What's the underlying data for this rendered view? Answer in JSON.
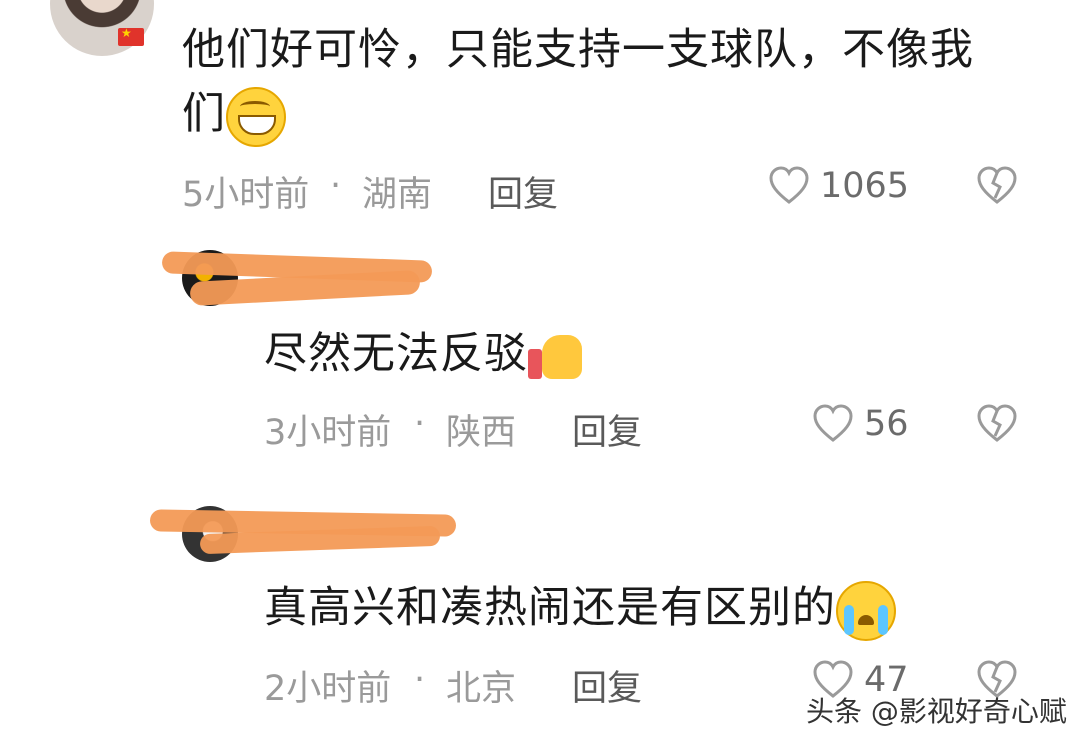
{
  "comments": [
    {
      "text": "他们好可怜，只能支持一支球队，不像我们",
      "emoji": "grinning-face-emoji",
      "time": "5小时前",
      "location": "湖南",
      "separator": "·",
      "reply_label": "回复",
      "likes": "1065"
    },
    {
      "text": "尽然无法反驳",
      "emoji": "thumbs-up-emoji",
      "time": "3小时前",
      "location": "陕西",
      "separator": "·",
      "reply_label": "回复",
      "likes": "56"
    },
    {
      "text": "真高兴和凑热闹还是有区别的",
      "emoji": "crying-face-emoji",
      "time": "2小时前",
      "location": "北京",
      "separator": "·",
      "reply_label": "回复",
      "likes": "47"
    }
  ],
  "watermark": "头条 @影视好奇心赋",
  "colors": {
    "redaction": "#f39a56",
    "meta_text": "#9a9a9a",
    "icon": "#9a9a9a"
  },
  "icons": [
    "heart-outline-icon",
    "broken-heart-icon"
  ]
}
